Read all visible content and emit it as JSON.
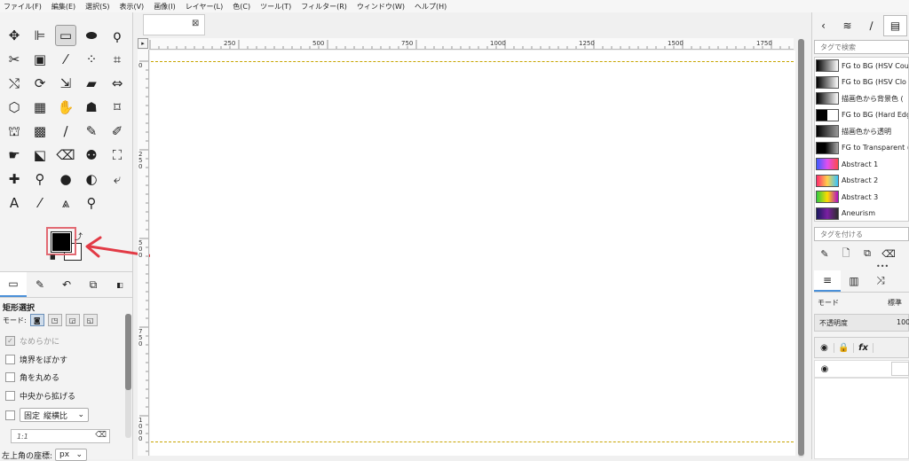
{
  "menubar": {
    "items": [
      "ファイル(F)",
      "編集(E)",
      "選択(S)",
      "表示(V)",
      "画像(I)",
      "レイヤー(L)",
      "色(C)",
      "ツール(T)",
      "フィルター(R)",
      "ウィンドウ(W)",
      "ヘルプ(H)"
    ]
  },
  "toolbox": {
    "tools": [
      {
        "name": "move-tool-icon",
        "glyph": "✥"
      },
      {
        "name": "align-tool-icon",
        "glyph": "⊫"
      },
      {
        "name": "rect-select-tool-icon",
        "glyph": "▭",
        "active": true
      },
      {
        "name": "ellipse-select-tool-icon",
        "glyph": "⬬"
      },
      {
        "name": "free-select-tool-icon",
        "glyph": "ϙ"
      },
      {
        "name": "scissors-select-tool-icon",
        "glyph": "✂"
      },
      {
        "name": "foreground-select-tool-icon",
        "glyph": "▣"
      },
      {
        "name": "fuzzy-select-tool-icon",
        "glyph": "⁄"
      },
      {
        "name": "select-by-color-tool-icon",
        "glyph": "⁘"
      },
      {
        "name": "crop-tool-icon",
        "glyph": "⌗"
      },
      {
        "name": "unified-transform-tool-icon",
        "glyph": "⤭"
      },
      {
        "name": "rotate-tool-icon",
        "glyph": "⟳"
      },
      {
        "name": "scale-tool-icon",
        "glyph": "⇲"
      },
      {
        "name": "shear-tool-icon",
        "glyph": "▰"
      },
      {
        "name": "flip-tool-icon",
        "glyph": "⇔"
      },
      {
        "name": "perspective-tool-icon",
        "glyph": "⬡"
      },
      {
        "name": "cage-tool-icon",
        "glyph": "▦"
      },
      {
        "name": "warp-tool-icon",
        "glyph": "✋"
      },
      {
        "name": "handle-transform-tool-icon",
        "glyph": "☗"
      },
      {
        "name": "3d-transform-tool-icon",
        "glyph": "⌑"
      },
      {
        "name": "bucket-fill-tool-icon",
        "glyph": "⛫"
      },
      {
        "name": "gradient-tool-icon",
        "glyph": "▩"
      },
      {
        "name": "paintbrush-tool-icon",
        "glyph": "∕"
      },
      {
        "name": "pencil-tool-icon",
        "glyph": "✎"
      },
      {
        "name": "mypaint-brush-tool-icon",
        "glyph": "✐"
      },
      {
        "name": "airbrush-tool-icon",
        "glyph": "☛"
      },
      {
        "name": "ink-tool-icon",
        "glyph": "⬕"
      },
      {
        "name": "eraser-tool-icon",
        "glyph": "⌫"
      },
      {
        "name": "clone-tool-icon",
        "glyph": "⚉"
      },
      {
        "name": "heal-tool-icon",
        "glyph": "⛶"
      },
      {
        "name": "smudge-tool-icon",
        "glyph": "✚"
      },
      {
        "name": "blur-tool-icon",
        "glyph": "⚲"
      },
      {
        "name": "dodge-burn-tool-icon",
        "glyph": "●"
      },
      {
        "name": "dodge-tool-icon",
        "glyph": "◐"
      },
      {
        "name": "paths-tool-icon",
        "glyph": "⤶"
      },
      {
        "name": "text-tool-icon",
        "glyph": "A"
      },
      {
        "name": "color-picker-tool-icon",
        "glyph": "⁄"
      },
      {
        "name": "measure-tool-icon",
        "glyph": "⩓"
      },
      {
        "name": "zoom-tool-icon",
        "glyph": "⚲"
      }
    ]
  },
  "dock_tabs": [
    "tool-options-tab",
    "device-status-tab",
    "undo-history-tab",
    "images-tab"
  ],
  "tool_options": {
    "title": "矩形選択",
    "mode_label": "モード:",
    "antialias_label": "なめらかに",
    "feather_label": "境界をぼかす",
    "rounded_label": "角を丸める",
    "expand_label": "中央から拡げる",
    "fixed_label": "固定",
    "fixed_select": "縦横比",
    "ratio_value": "1:1",
    "position_label": "左上角の座標:",
    "unit_select": "px"
  },
  "image_tab": {
    "close_glyph": "⊠"
  },
  "ruler": {
    "h_labels": [
      "250",
      "500",
      "750",
      "1000",
      "1250",
      "1500",
      "1750"
    ],
    "v_labels": [
      "0",
      "250",
      "500",
      "750",
      "1000"
    ]
  },
  "right_panel": {
    "tag_search_placeholder": "タグで検索",
    "gradients": [
      {
        "name": "FG to BG (HSV Cou",
        "css": "linear-gradient(to right,#000,#fff)"
      },
      {
        "name": "FG to BG (HSV Clo",
        "css": "linear-gradient(to right,#000,#fff)"
      },
      {
        "name": "描画色から背景色 (",
        "css": "linear-gradient(to right,#000,#fff)"
      },
      {
        "name": "FG to BG (Hard Edg",
        "css": "linear-gradient(to right,#000 50%,#fff 50%)"
      },
      {
        "name": "描画色から透明",
        "css": "linear-gradient(to right,#000,#999)"
      },
      {
        "name": "FG to Transparent (",
        "css": "linear-gradient(to right,#000 40%,#aaa)"
      },
      {
        "name": "Abstract 1",
        "css": "linear-gradient(to right,#3b5cff,#e14ef0,#ff4a4a)"
      },
      {
        "name": "Abstract 2",
        "css": "linear-gradient(to right,#ff2a6d,#ffd24a,#35c3ff)"
      },
      {
        "name": "Abstract 3",
        "css": "linear-gradient(to right,#2ecc40,#ffdc00,#b10dc9)"
      },
      {
        "name": "Aneurism",
        "css": "linear-gradient(to right,#1a1a5e,#7b1fa2,#2d2d2d)"
      }
    ],
    "tag_field_placeholder": "タグを付ける",
    "layers_mode_label": "モード",
    "layers_mode_value": "標準",
    "opacity_label": "不透明度",
    "opacity_value": "100"
  }
}
